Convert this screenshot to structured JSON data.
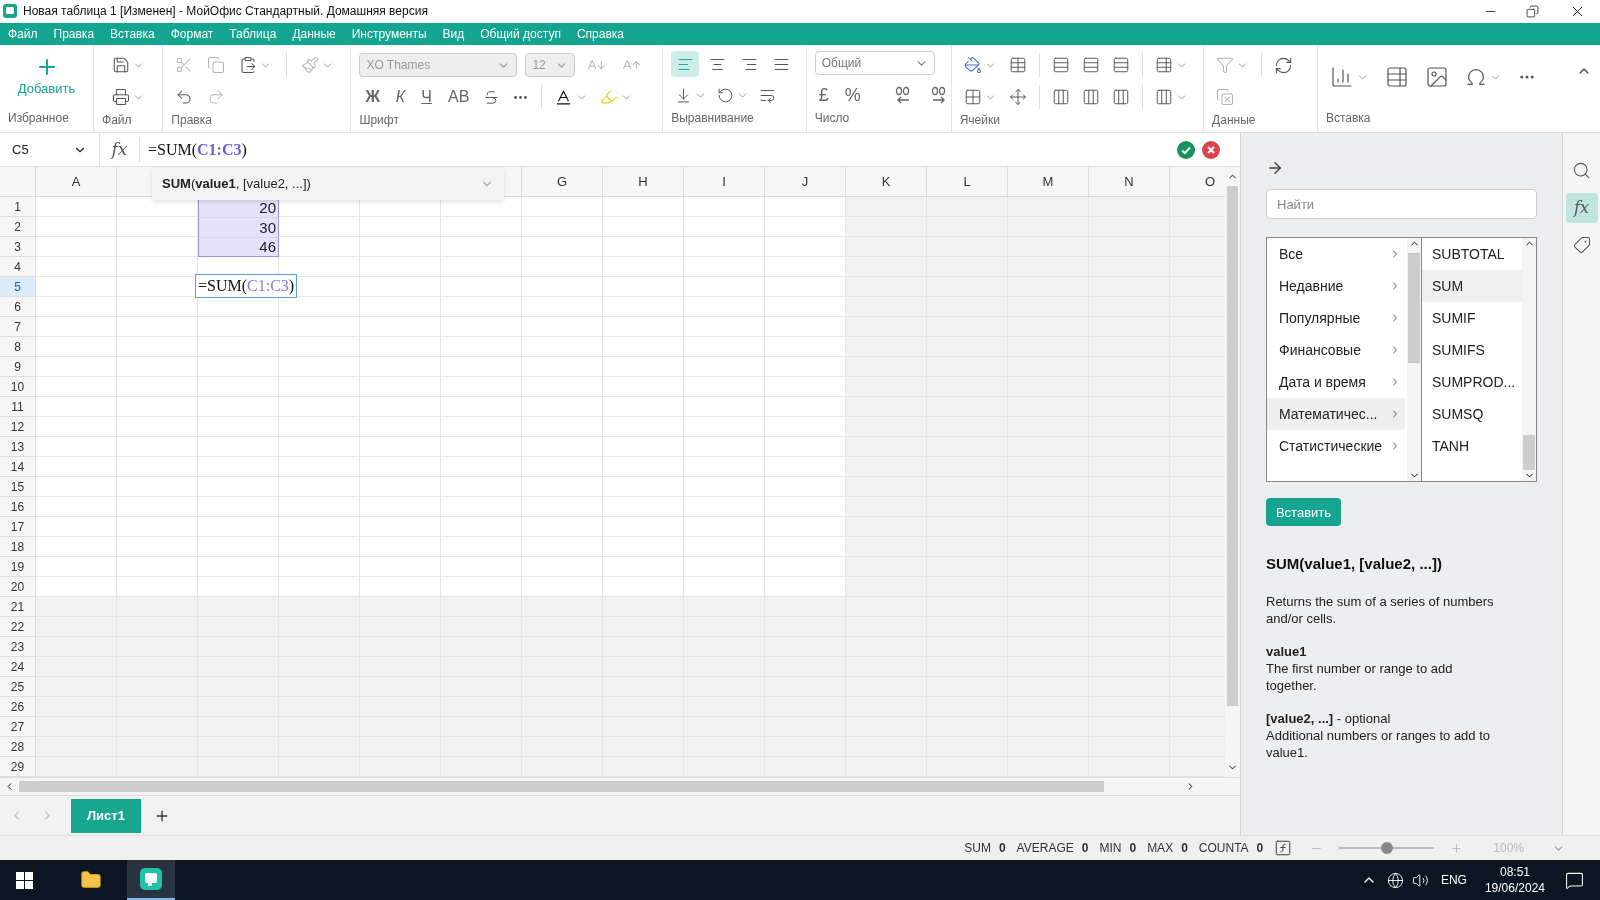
{
  "window": {
    "title": "Новая таблица 1 [Изменен] - МойОфис Стандартный. Домашняя версия"
  },
  "menu": [
    "Файл",
    "Правка",
    "Вставка",
    "Формат",
    "Таблица",
    "Данные",
    "Инструменты",
    "Вид",
    "Общий доступ",
    "Справка"
  ],
  "ribbon": {
    "groups": [
      "Избранное",
      "Файл",
      "Правка",
      "Шрифт",
      "Выравнивание",
      "Число",
      "Ячейки",
      "Данные",
      "Вставка"
    ],
    "add_button": "Добавить",
    "font": {
      "family": "XO Thames",
      "size": "12",
      "disabled": true
    },
    "font_styles": [
      {
        "label": "Ж",
        "kind": "bold"
      },
      {
        "label": "К",
        "kind": "italic"
      },
      {
        "label": "Ч",
        "kind": "underline"
      },
      {
        "label": "АВ",
        "kind": "caps"
      }
    ],
    "alignment": [
      {
        "kind": "left",
        "selected": true
      },
      {
        "kind": "center",
        "selected": false
      },
      {
        "kind": "right",
        "selected": false
      },
      {
        "kind": "justify",
        "selected": false
      }
    ],
    "number_format": "Общий",
    "number_symbols": [
      "£",
      "%"
    ]
  },
  "formula_bar": {
    "cell_ref": "C5",
    "function_icon": "fx",
    "formula": [
      {
        "text": "=SUM(",
        "kind": "plain"
      },
      {
        "text": "C1:C3",
        "kind": "ref"
      },
      {
        "text": ")",
        "kind": "plain"
      }
    ]
  },
  "hint": {
    "signature": "**SUM**(**value1**, [value2, ...])"
  },
  "sheet": {
    "columns": [
      {
        "label": "A"
      },
      {},
      {},
      {},
      {},
      {},
      {
        "label": "G"
      },
      {
        "label": "H"
      },
      {
        "label": "I"
      },
      {
        "label": "J"
      },
      {
        "label": "K"
      },
      {
        "label": "L"
      },
      {
        "label": "M"
      },
      {
        "label": "N"
      },
      {
        "label": "O"
      }
    ],
    "rows": [
      {
        "label": "1",
        "selected": false,
        "cells": [
          {},
          {},
          {
            "value": "20",
            "selected": true
          }
        ]
      },
      {
        "label": "2",
        "selected": false,
        "cells": [
          {},
          {},
          {
            "value": "30",
            "selected": true
          }
        ]
      },
      {
        "label": "3",
        "selected": false,
        "cells": [
          {},
          {},
          {
            "value": "46",
            "selected": true
          }
        ]
      },
      {
        "label": "4",
        "selected": false
      },
      {
        "label": "5",
        "selected": true,
        "cells": [
          {},
          {},
          {
            "editing": true,
            "formula": [
              {
                "text": "=SUM(",
                "kind": "plain"
              },
              {
                "text": "C1:C3",
                "kind": "ref"
              },
              {
                "text": ")",
                "kind": "plain"
              }
            ]
          }
        ]
      },
      {
        "label": "6",
        "selected": false
      },
      {
        "label": "7",
        "selected": false
      },
      {
        "label": "8",
        "selected": false
      },
      {
        "label": "9",
        "selected": false
      },
      {
        "label": "10",
        "selected": false
      },
      {
        "label": "11",
        "selected": false
      },
      {
        "label": "12",
        "selected": false
      },
      {
        "label": "13",
        "selected": false
      },
      {
        "label": "14",
        "selected": false
      },
      {
        "label": "15",
        "selected": false
      },
      {
        "label": "16",
        "selected": false
      },
      {
        "label": "17",
        "selected": false
      },
      {
        "label": "18",
        "selected": false
      },
      {
        "label": "19",
        "selected": false
      },
      {
        "label": "20",
        "selected": false
      },
      {
        "label": "21",
        "selected": false
      },
      {
        "label": "22",
        "selected": false
      },
      {
        "label": "23",
        "selected": false
      },
      {
        "label": "24",
        "selected": false
      },
      {
        "label": "25",
        "selected": false
      },
      {
        "label": "26",
        "selected": false
      },
      {
        "label": "27",
        "selected": false
      },
      {
        "label": "28",
        "selected": false
      },
      {
        "label": "29",
        "selected": false
      }
    ]
  },
  "sheet_tabs": [
    {
      "label": "Лист1",
      "selected": true
    }
  ],
  "functions_panel": {
    "search": {
      "placeholder": "Найти"
    },
    "categories": [
      {
        "label": "Все",
        "selected": false
      },
      {
        "label": "Недавние",
        "selected": false
      },
      {
        "label": "Популярные",
        "selected": false
      },
      {
        "label": "Финансовые",
        "selected": false
      },
      {
        "label": "Дата и время",
        "selected": false
      },
      {
        "label": "Математичес...",
        "selected": true
      },
      {
        "label": "Статистические",
        "selected": false
      }
    ],
    "functions": [
      {
        "label": "SUBTOTAL",
        "selected": false
      },
      {
        "label": "SUM",
        "selected": true
      },
      {
        "label": "SUMIF",
        "selected": false
      },
      {
        "label": "SUMIFS",
        "selected": false
      },
      {
        "label": "SUMPROD...",
        "selected": false
      },
      {
        "label": "SUMSQ",
        "selected": false
      },
      {
        "label": "TANH",
        "selected": false
      }
    ],
    "insert_button": "Вставить",
    "description": {
      "signature": "SUM(value1, [value2, ...])",
      "summary": "Returns the sum of a series of numbers and/or cells.",
      "arguments": [
        {
          "name": "**value1**",
          "text": "The first number or range to add together."
        },
        {
          "name": "**[value2, ...]** - optional",
          "text": "Additional numbers or ranges to add to value1."
        }
      ]
    },
    "side_icon": "fx"
  },
  "status_bar": {
    "stats": [
      {
        "label": "SUM",
        "value": "0"
      },
      {
        "label": "AVERAGE",
        "value": "0"
      },
      {
        "label": "MIN",
        "value": "0"
      },
      {
        "label": "MAX",
        "value": "0"
      },
      {
        "label": "COUNTA",
        "value": "0"
      }
    ],
    "zoom": {
      "level": 0.5,
      "reading": "100%"
    }
  },
  "taskbar": {
    "language": "ENG",
    "time": "08:51",
    "date": "19/06/2024"
  }
}
